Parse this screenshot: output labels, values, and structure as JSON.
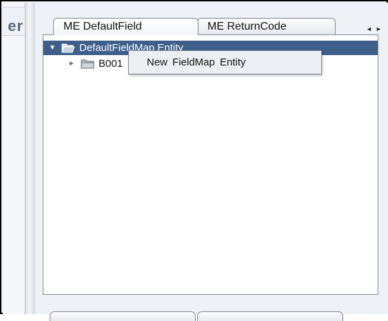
{
  "left_panel": {
    "title_fragment": "er"
  },
  "tabs": [
    {
      "label": "ME DefaultField",
      "active": true
    },
    {
      "label": "ME ReturnCode",
      "active": false
    }
  ],
  "tab_scroll": {
    "left": "◄",
    "right": "►"
  },
  "tree": {
    "root": {
      "label": "DefaultFieldMap Entity",
      "expanded": true,
      "selected": true
    },
    "children": [
      {
        "label": "B001",
        "expanded": false
      }
    ]
  },
  "context_menu": {
    "items": [
      {
        "label": "New FieldMap Entity"
      }
    ]
  },
  "colors": {
    "selection": "#3d5f8a",
    "panel_bg": "#eef1f5",
    "border": "#7f8894"
  }
}
